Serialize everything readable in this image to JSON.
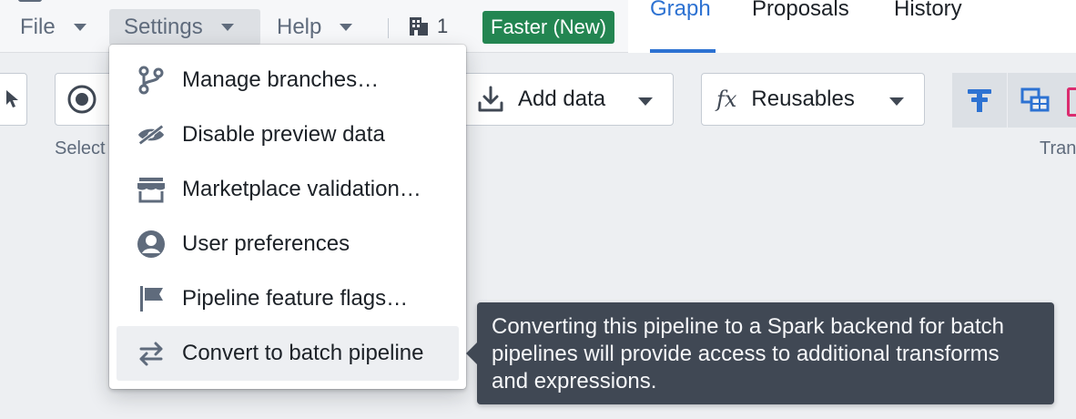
{
  "menubar": {
    "file": "File",
    "settings": "Settings",
    "help": "Help",
    "org_count": "1",
    "badge": "Faster (New)"
  },
  "tabs": {
    "graph": "Graph",
    "proposals": "Proposals",
    "history": "History",
    "active": "Graph"
  },
  "toolbar": {
    "select_label": "Select",
    "add_data": "Add data",
    "reusables": "Reusables",
    "reusables_icon_text": "fx",
    "transform_label": "Tran"
  },
  "settings_menu": {
    "items": [
      {
        "label": "Manage branches…",
        "icon": "git-branch-icon"
      },
      {
        "label": "Disable preview data",
        "icon": "eye-off-icon"
      },
      {
        "label": "Marketplace validation…",
        "icon": "shop-icon"
      },
      {
        "label": "User preferences",
        "icon": "user-icon"
      },
      {
        "label": "Pipeline feature flags…",
        "icon": "flag-icon"
      },
      {
        "label": "Convert to batch pipeline",
        "icon": "swap-horizontal-icon",
        "highlighted": true
      }
    ]
  },
  "tooltip": {
    "text": "Converting this pipeline to a Spark backend for batch pipelines will provide access to additional transforms and expressions."
  },
  "colors": {
    "accent": "#2d72d2",
    "badge_green": "#238551",
    "tooltip_bg": "#404854",
    "pink_icon": "#db2c6f"
  }
}
